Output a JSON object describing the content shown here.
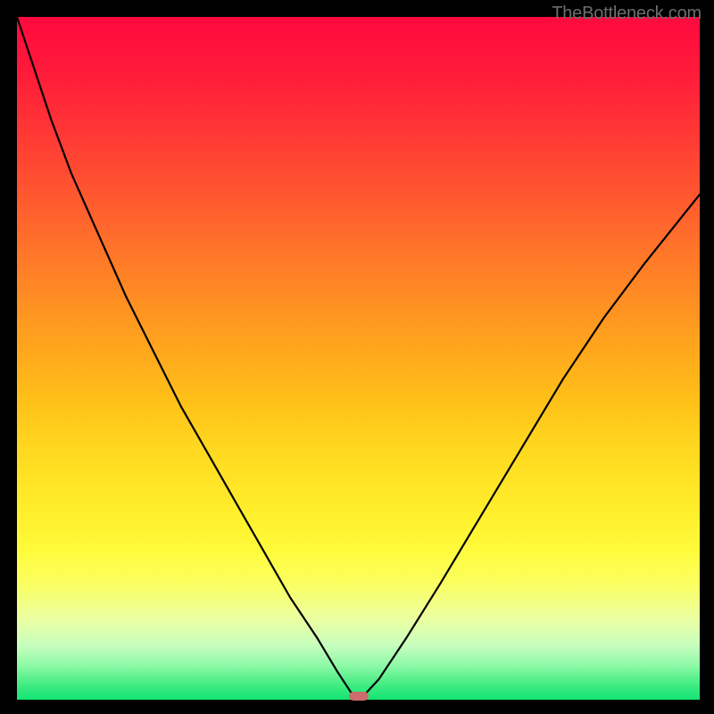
{
  "attribution": "TheBottleneck.com",
  "chart_data": {
    "type": "line",
    "title": "",
    "xlabel": "",
    "ylabel": "",
    "xlim": [
      0,
      1
    ],
    "ylim": [
      0,
      1
    ],
    "series": [
      {
        "name": "bottleneck-curve",
        "x": [
          0.0,
          0.02,
          0.05,
          0.08,
          0.12,
          0.16,
          0.2,
          0.24,
          0.28,
          0.32,
          0.36,
          0.4,
          0.44,
          0.47,
          0.493,
          0.507,
          0.53,
          0.57,
          0.62,
          0.68,
          0.74,
          0.8,
          0.86,
          0.92,
          1.0
        ],
        "y": [
          1.0,
          0.94,
          0.85,
          0.77,
          0.68,
          0.59,
          0.51,
          0.43,
          0.36,
          0.29,
          0.22,
          0.15,
          0.09,
          0.04,
          0.005,
          0.005,
          0.03,
          0.09,
          0.17,
          0.27,
          0.37,
          0.47,
          0.56,
          0.64,
          0.74
        ]
      }
    ],
    "marker": {
      "x": 0.5,
      "y": 0.005
    },
    "gradient_stops": [
      {
        "pos": 0.0,
        "color": "#ff0a3e"
      },
      {
        "pos": 0.5,
        "color": "#ffd020"
      },
      {
        "pos": 0.8,
        "color": "#f8ff50"
      },
      {
        "pos": 1.0,
        "color": "#12e574"
      }
    ]
  }
}
